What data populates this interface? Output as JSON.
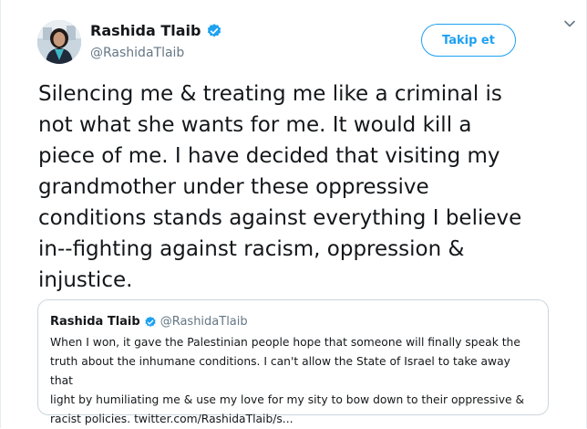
{
  "tweet": {
    "author": {
      "name": "Rashida Tlaib",
      "handle": "@RashidaTlaib",
      "verified": true,
      "avatar": "profile-photo"
    },
    "follow_label": "Takip et",
    "more_icon": "chevron-down-icon",
    "text": "Silencing me & treating me like a criminal is\nnot what she wants for me. It would kill a\npiece of me. I have decided that visiting my\ngrandmother under these oppressive\nconditions stands against everything I believe\nin--fighting against racism, oppression &\ninjustice."
  },
  "quoted_tweet": {
    "author": {
      "name": "Rashida Tlaib",
      "handle": "@RashidaTlaib",
      "verified": true
    },
    "text": "When I won, it gave the Palestinian people hope that someone will finally speak the\ntruth about the inhumane conditions. I can't allow the State of Israel to take away that\nlight by humiliating me & use my love for my sity to bow down to their oppressive &\nracist policies.",
    "link": "twitter.com/RashidaTlaib/s..."
  },
  "colors": {
    "accent": "#1da1f2",
    "text": "#14171a",
    "secondary_text": "#657786",
    "border": "#ccd6dd"
  }
}
